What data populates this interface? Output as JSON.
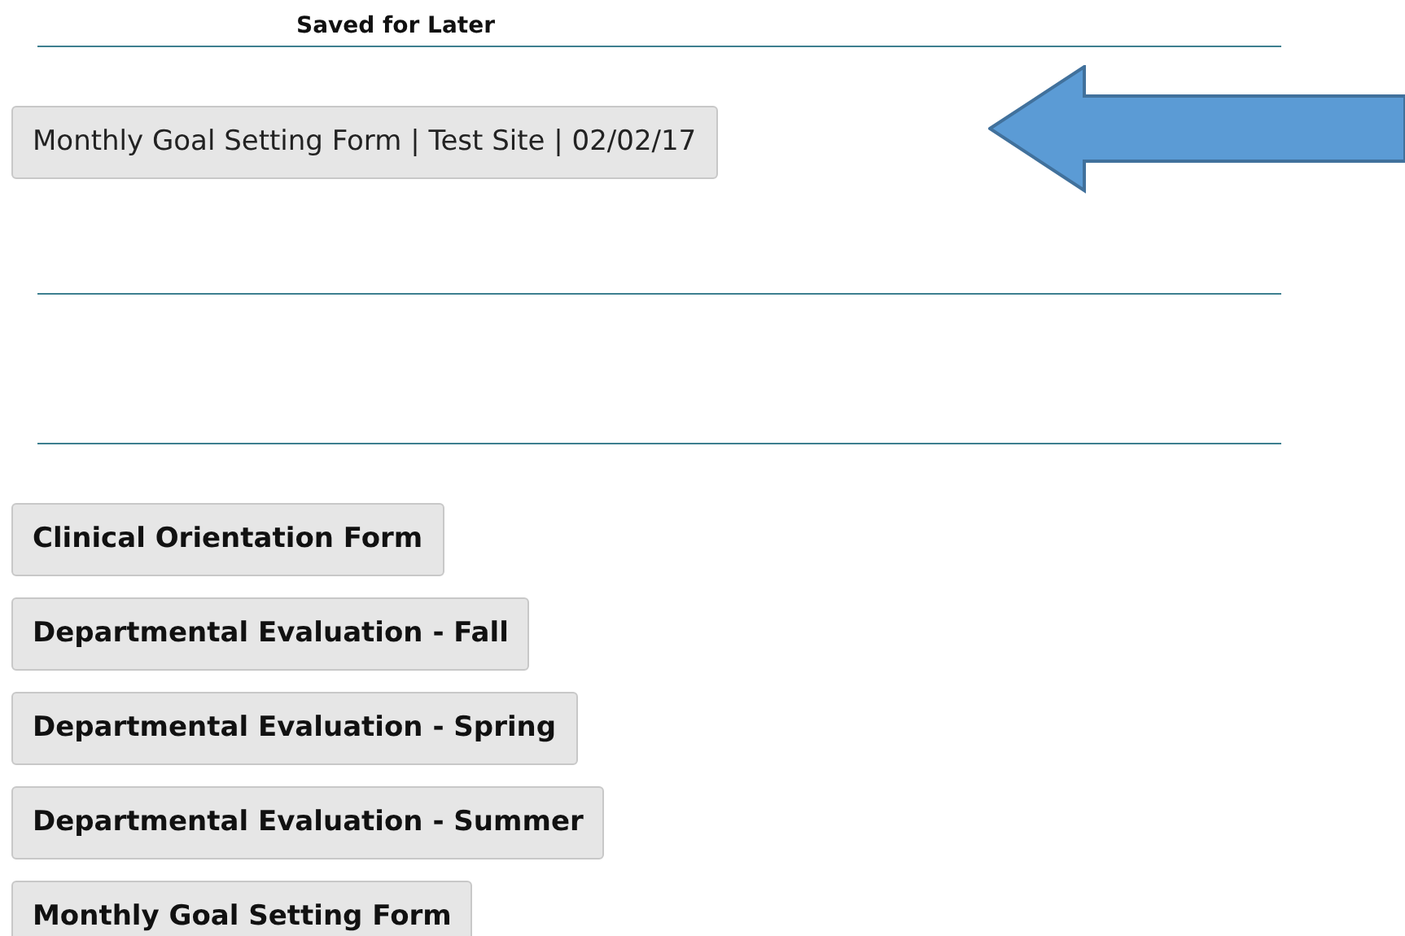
{
  "heading": "Saved for Later",
  "saved_items": [
    {
      "label": "Monthly Goal Setting Form | Test Site | 02/02/17"
    }
  ],
  "forms": [
    {
      "label": "Clinical Orientation Form"
    },
    {
      "label": "Departmental Evaluation - Fall"
    },
    {
      "label": "Departmental Evaluation - Spring"
    },
    {
      "label": "Departmental Evaluation - Summer"
    },
    {
      "label": "Monthly Goal Setting Form"
    }
  ]
}
